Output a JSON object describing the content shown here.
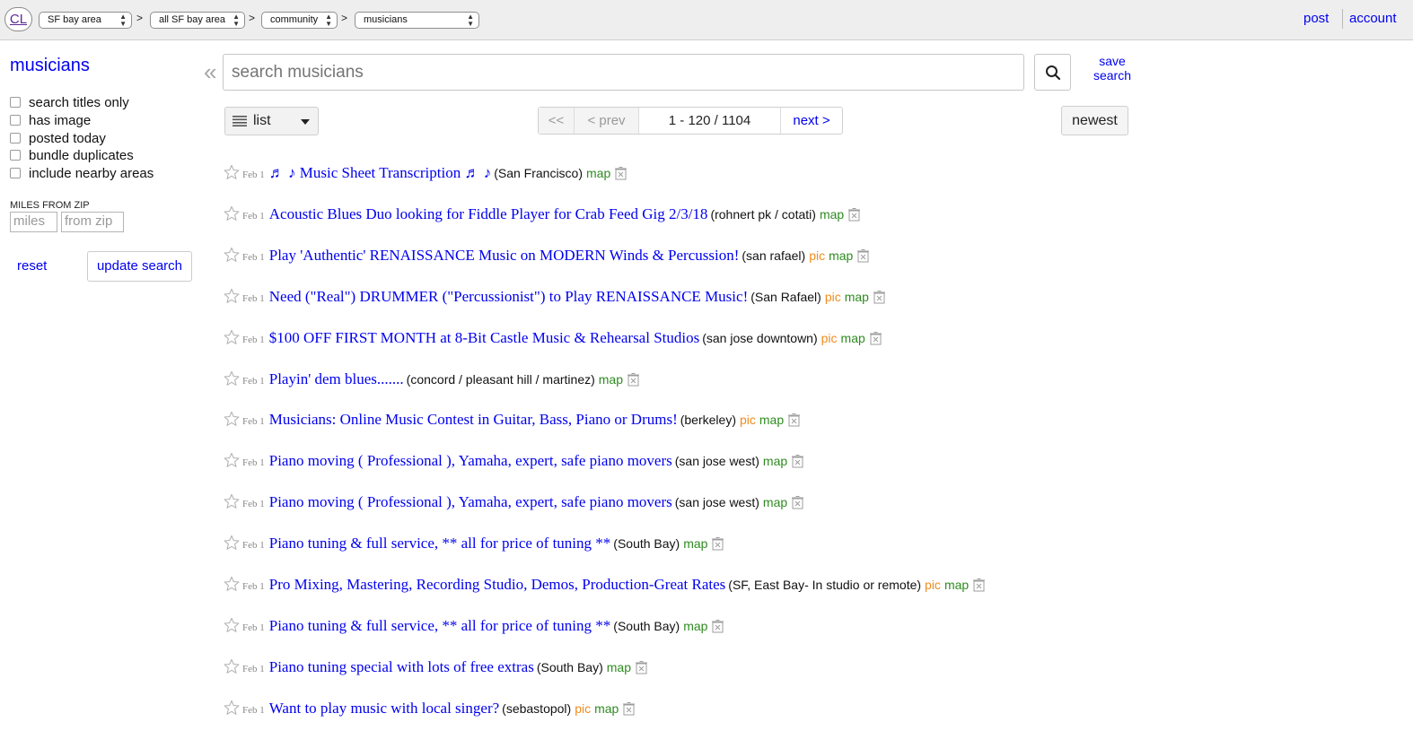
{
  "header": {
    "logo": "CL",
    "breadcrumbs": [
      "SF bay area",
      "all SF bay area",
      "community",
      "musicians"
    ],
    "separator": ">",
    "post_link": "post",
    "account_link": "account"
  },
  "sidebar": {
    "title": "musicians",
    "filters": [
      "search titles only",
      "has image",
      "posted today",
      "bundle duplicates",
      "include nearby areas"
    ],
    "miles_label": "MILES FROM ZIP",
    "miles_placeholder": "miles",
    "zip_placeholder": "from zip",
    "reset_label": "reset",
    "update_label": "update search"
  },
  "search": {
    "collapse_glyph": "«",
    "placeholder": "search musicians",
    "save_line1": "save",
    "save_line2": "search"
  },
  "controls": {
    "view_label": "list",
    "first_label": "<<",
    "prev_label": "< prev",
    "range_label": "1 - 120 / 1104",
    "next_label": "next >",
    "sort_label": "newest"
  },
  "icons": {
    "star": "star-icon",
    "hide": "hide-posting-icon",
    "search": "search-icon",
    "view": "list-view-icon"
  },
  "colors": {
    "link": "#0000ee",
    "pic": "#f08c1e",
    "map": "#2e8b20",
    "date": "#888888",
    "header_bg": "#eeeeee"
  },
  "results": [
    {
      "date": "Feb 1",
      "title": "♬ ♪ Music Sheet Transcription ♬ ♪",
      "hood": "(San Francisco)",
      "pic": "",
      "map": "map"
    },
    {
      "date": "Feb 1",
      "title": "Acoustic Blues Duo looking for Fiddle Player for Crab Feed Gig 2/3/18",
      "hood": "(rohnert pk / cotati)",
      "pic": "",
      "map": "map"
    },
    {
      "date": "Feb 1",
      "title": "Play 'Authentic' RENAISSANCE Music on MODERN Winds & Percussion!",
      "hood": "(san rafael)",
      "pic": "pic",
      "map": "map"
    },
    {
      "date": "Feb 1",
      "title": "Need (\"Real\") DRUMMER (\"Percussionist\") to Play RENAISSANCE Music!",
      "hood": "(San Rafael)",
      "pic": "pic",
      "map": "map"
    },
    {
      "date": "Feb 1",
      "title": "$100 OFF FIRST MONTH at 8-Bit Castle Music & Rehearsal Studios",
      "hood": "(san jose downtown)",
      "pic": "pic",
      "map": "map"
    },
    {
      "date": "Feb 1",
      "title": "Playin' dem blues.......",
      "hood": "(concord / pleasant hill / martinez)",
      "pic": "",
      "map": "map"
    },
    {
      "date": "Feb 1",
      "title": "Musicians: Online Music Contest in Guitar, Bass, Piano or Drums!",
      "hood": "(berkeley)",
      "pic": "pic",
      "map": "map"
    },
    {
      "date": "Feb 1",
      "title": "Piano moving ( Professional ), Yamaha, expert, safe piano movers",
      "hood": "(san jose west)",
      "pic": "",
      "map": "map"
    },
    {
      "date": "Feb 1",
      "title": "Piano moving ( Professional ), Yamaha, expert, safe piano movers",
      "hood": "(san jose west)",
      "pic": "",
      "map": "map"
    },
    {
      "date": "Feb 1",
      "title": "Piano tuning & full service, ** all for price of tuning **",
      "hood": "(South Bay)",
      "pic": "",
      "map": "map"
    },
    {
      "date": "Feb 1",
      "title": "Pro Mixing, Mastering, Recording Studio, Demos, Production-Great Rates",
      "hood": "(SF, East Bay- In studio or remote)",
      "pic": "pic",
      "map": "map"
    },
    {
      "date": "Feb 1",
      "title": "Piano tuning & full service, ** all for price of tuning **",
      "hood": "(South Bay)",
      "pic": "",
      "map": "map"
    },
    {
      "date": "Feb 1",
      "title": "Piano tuning special with lots of free extras",
      "hood": "(South Bay)",
      "pic": "",
      "map": "map"
    },
    {
      "date": "Feb 1",
      "title": "Want to play music with local singer?",
      "hood": "(sebastopol)",
      "pic": "pic",
      "map": "map"
    }
  ]
}
